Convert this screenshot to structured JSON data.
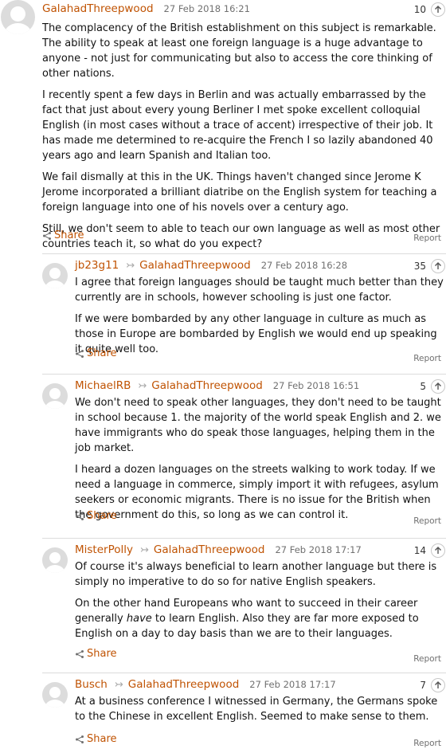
{
  "comments": [
    {
      "author": "GalahadThreepwood",
      "reply_to": "",
      "time": "27 Feb 2018 16:21",
      "recommends": "10",
      "paragraphs": [
        "The complacency of the British establishment on this subject is remarkable. The ability to speak at least one foreign language is a huge advantage to anyone - not just for communicating but also to access the core thinking of other nations.",
        "I recently spent a few days in Berlin and was actually embarrassed by the fact that just about every young Berliner I met spoke excellent colloquial English (in most cases without a trace of accent) irrespective of their job. It has made me determined to re-acquire the French I so lazily abandoned 40 years ago and learn Spanish and Italian too.",
        "We fail dismally at this in the UK. Things haven't changed since Jerome K Jerome incorporated a brilliant diatribe on the English system for teaching a foreign language into one of his novels over a century ago.",
        "Still, we don't seem to able to teach our own language as well as most other countries teach it, so what do you expect?"
      ],
      "share_label": "Share",
      "report_label": "Report"
    },
    {
      "author": "jb23g11",
      "reply_to": "GalahadThreepwood",
      "time": "27 Feb 2018 16:28",
      "recommends": "35",
      "paragraphs": [
        "I agree that foreign languages should be taught much better than they currently are in schools, however schooling is just one factor.",
        "If we were bombarded by any other language in culture as much as those in Europe are bombarded by English we would end up speaking it quite well too."
      ],
      "share_label": "Share",
      "report_label": "Report"
    },
    {
      "author": "MichaelRB",
      "reply_to": "GalahadThreepwood",
      "time": "27 Feb 2018 16:51",
      "recommends": "5",
      "paragraphs": [
        "We don't need to speak other languages, they don't need to be taught in school because 1. the majority of the world speak English and 2. we have immigrants who do speak those languages, helping them in the job market.",
        "I heard a dozen languages on the streets walking to work today. If we need a language in commerce, simply import it with refugees, asylum seekers or economic migrants. There is no issue for the British when the government do this, so long as we can control it."
      ],
      "share_label": "Share",
      "report_label": "Report"
    },
    {
      "author": "MisterPolly",
      "reply_to": "GalahadThreepwood",
      "time": "27 Feb 2018 17:17",
      "recommends": "14",
      "paragraphs": [
        "Of course it's always beneficial to learn another language but there is simply no imperative to do so for native English speakers.",
        "On the other hand Europeans who want to succeed in their career generally have to learn English. Also they are far more exposed to English on a day to day basis than we are to their languages."
      ],
      "emphasis_word": "have",
      "share_label": "Share",
      "report_label": "Report"
    },
    {
      "author": "Busch",
      "reply_to": "GalahadThreepwood",
      "time": "27 Feb 2018 17:17",
      "recommends": "7",
      "paragraphs": [
        "At a business conference I witnessed in Germany, the Germans spoke to the Chinese in excellent English. Seemed to make sense to them."
      ],
      "share_label": "Share",
      "report_label": "Report"
    }
  ],
  "icons": {
    "avatar": "default-avatar-icon",
    "reply_arrow": "reply-arrow-icon",
    "recommend": "up-arrow-icon",
    "share": "share-icon"
  },
  "colors": {
    "accent": "#c05303",
    "meta": "#707070",
    "divider": "#dcdcdc",
    "avatar": "#dcdcdc"
  }
}
